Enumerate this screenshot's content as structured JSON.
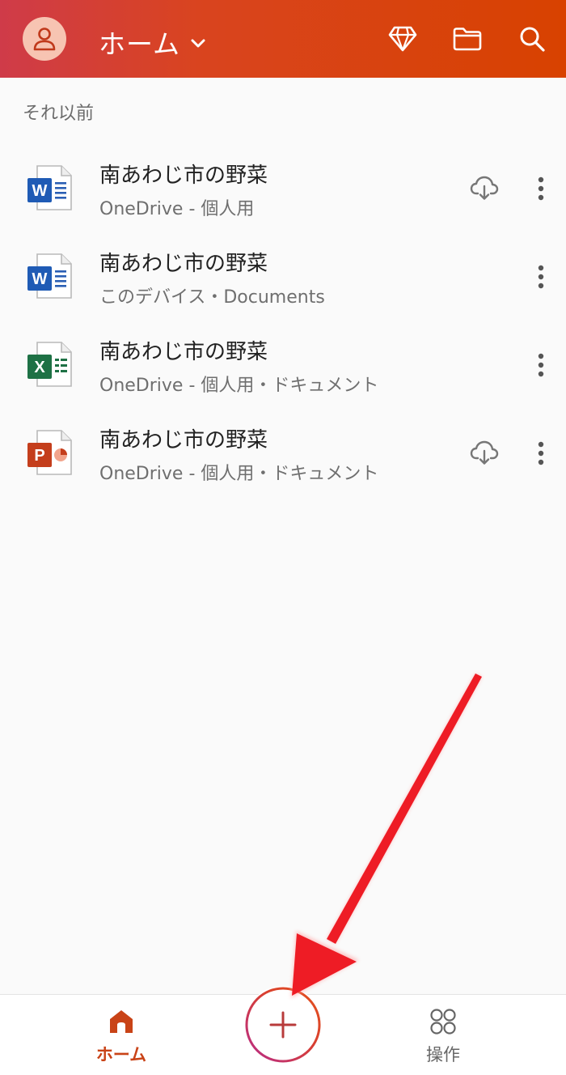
{
  "header": {
    "title": "ホーム",
    "colors": {
      "start": "#cf3b49",
      "end": "#d84200"
    },
    "icons": [
      "avatar-icon",
      "chevron-down-icon",
      "premium-diamond-icon",
      "folder-icon",
      "search-icon"
    ]
  },
  "section": {
    "label": "それ以前"
  },
  "files": [
    {
      "name": "南あわじ市の野菜",
      "location": "OneDrive - 個人用",
      "app": "word",
      "icon": "word-file-icon",
      "cloud": true
    },
    {
      "name": "南あわじ市の野菜",
      "location": "このデバイス・Documents",
      "app": "word",
      "icon": "word-file-icon",
      "cloud": false
    },
    {
      "name": "南あわじ市の野菜",
      "location": "OneDrive - 個人用・ドキュメント",
      "app": "excel",
      "icon": "excel-file-icon",
      "cloud": false
    },
    {
      "name": "南あわじ市の野菜",
      "location": "OneDrive - 個人用・ドキュメント",
      "app": "powerpoint",
      "icon": "powerpoint-file-icon",
      "cloud": true
    }
  ],
  "bottom_nav": {
    "home_label": "ホーム",
    "actions_label": "操作",
    "accent_color": "#c94317"
  },
  "fab": {
    "label": "+"
  }
}
